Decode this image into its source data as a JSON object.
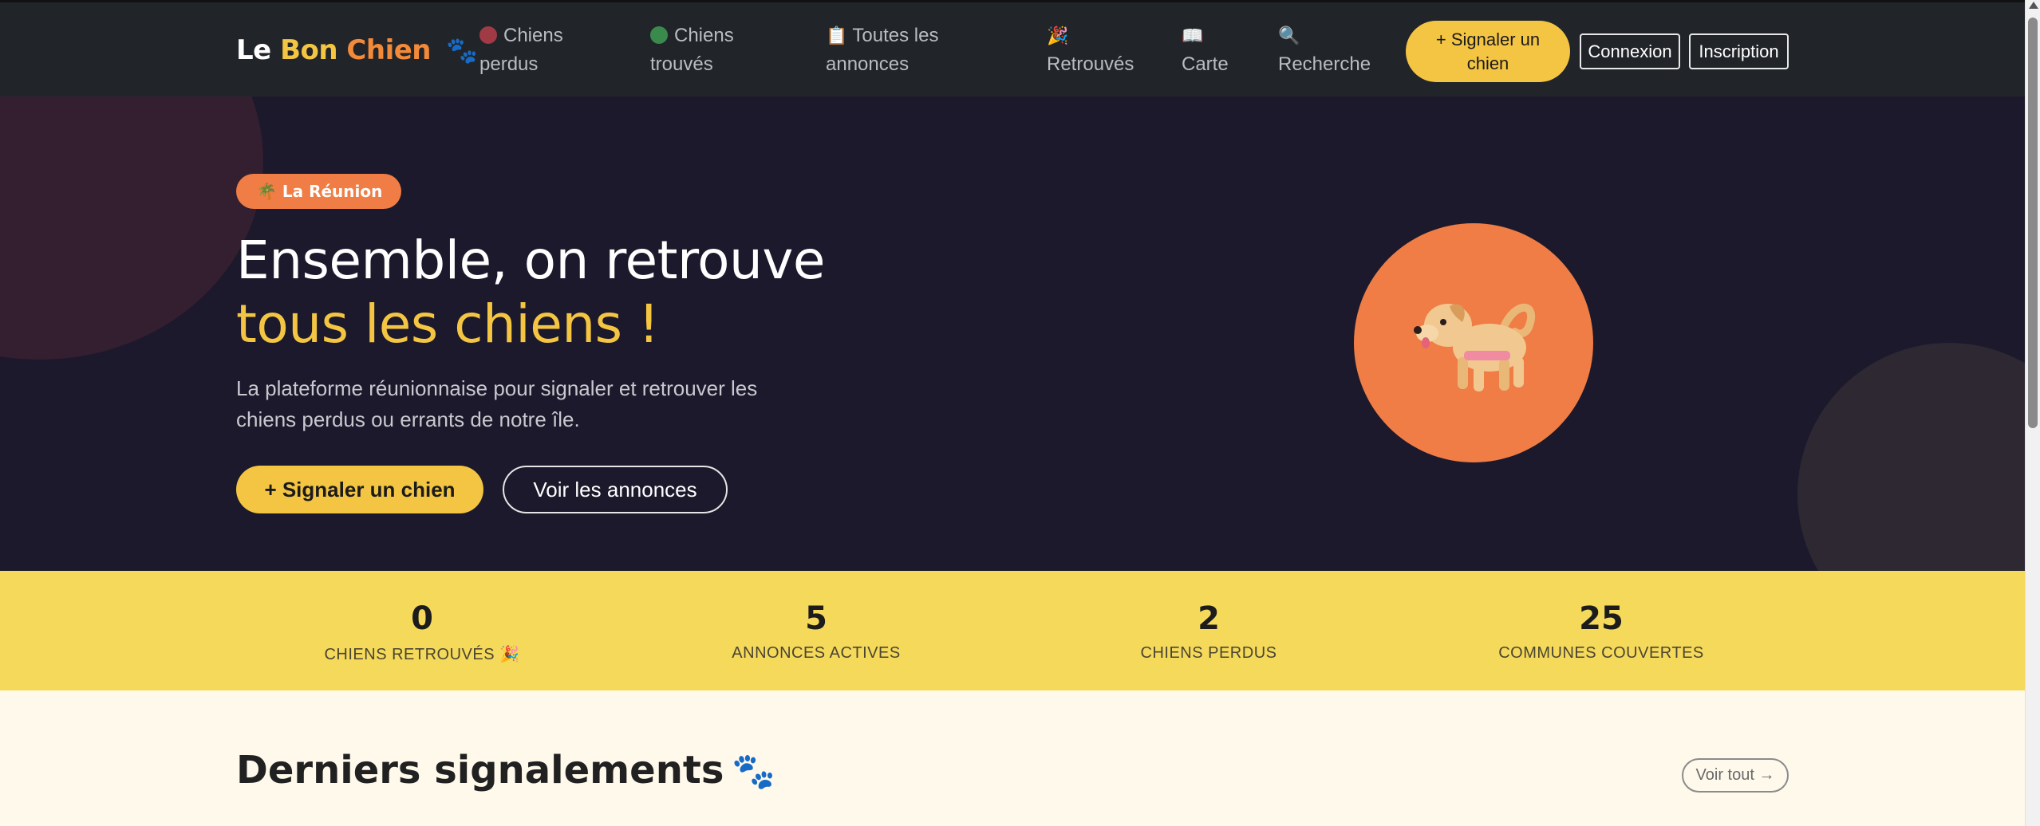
{
  "brand": {
    "word1": "Le",
    "word2": "Bon",
    "word3": "Chien",
    "icon": "paw-icon"
  },
  "nav": {
    "lost": {
      "icon": "red-circle-icon",
      "line1": "Chiens",
      "line2": "perdus"
    },
    "found": {
      "icon": "green-circle-icon",
      "line1": "Chiens",
      "line2": "trouvés"
    },
    "all": {
      "icon": "clipboard-icon",
      "line1": "Toutes les",
      "line2": "annonces"
    },
    "reunited": {
      "icon": "party-popper-icon",
      "label": "Retrouvés"
    },
    "map": {
      "icon": "map-icon",
      "label": "Carte"
    },
    "search": {
      "icon": "magnifier-icon",
      "label": "Recherche"
    },
    "report_line1": "+ Signaler un",
    "report_line2": "chien",
    "login": "Connexion",
    "signup": "Inscription"
  },
  "hero": {
    "badge": "🌴 La Réunion",
    "title_line1": "Ensemble, on retrouve",
    "title_line2": "tous les chiens !",
    "subtitle_line1": "La plateforme réunionnaise pour signaler et retrouver les",
    "subtitle_line2": "chiens perdus ou errants de notre île.",
    "primary_button": "+ Signaler un chien",
    "secondary_button": "Voir les annonces",
    "illustration": "dog-icon"
  },
  "stats": [
    {
      "value": "0",
      "label": "CHIENS RETROUVÉS 🎉"
    },
    {
      "value": "5",
      "label": "ANNONCES ACTIVES"
    },
    {
      "value": "2",
      "label": "CHIENS PERDUS"
    },
    {
      "value": "25",
      "label": "COMMUNES COUVERTES"
    }
  ],
  "latest": {
    "title": "Derniers signalements",
    "title_icon": "🐾",
    "see_all": "Voir tout →"
  },
  "colors": {
    "navbar": "#212529",
    "hero_bg": "#1b192b",
    "accent_yellow": "#f4c542",
    "accent_orange": "#ef7d45",
    "stats_bg": "#f5d95a",
    "page_bg": "#fff9ec"
  }
}
